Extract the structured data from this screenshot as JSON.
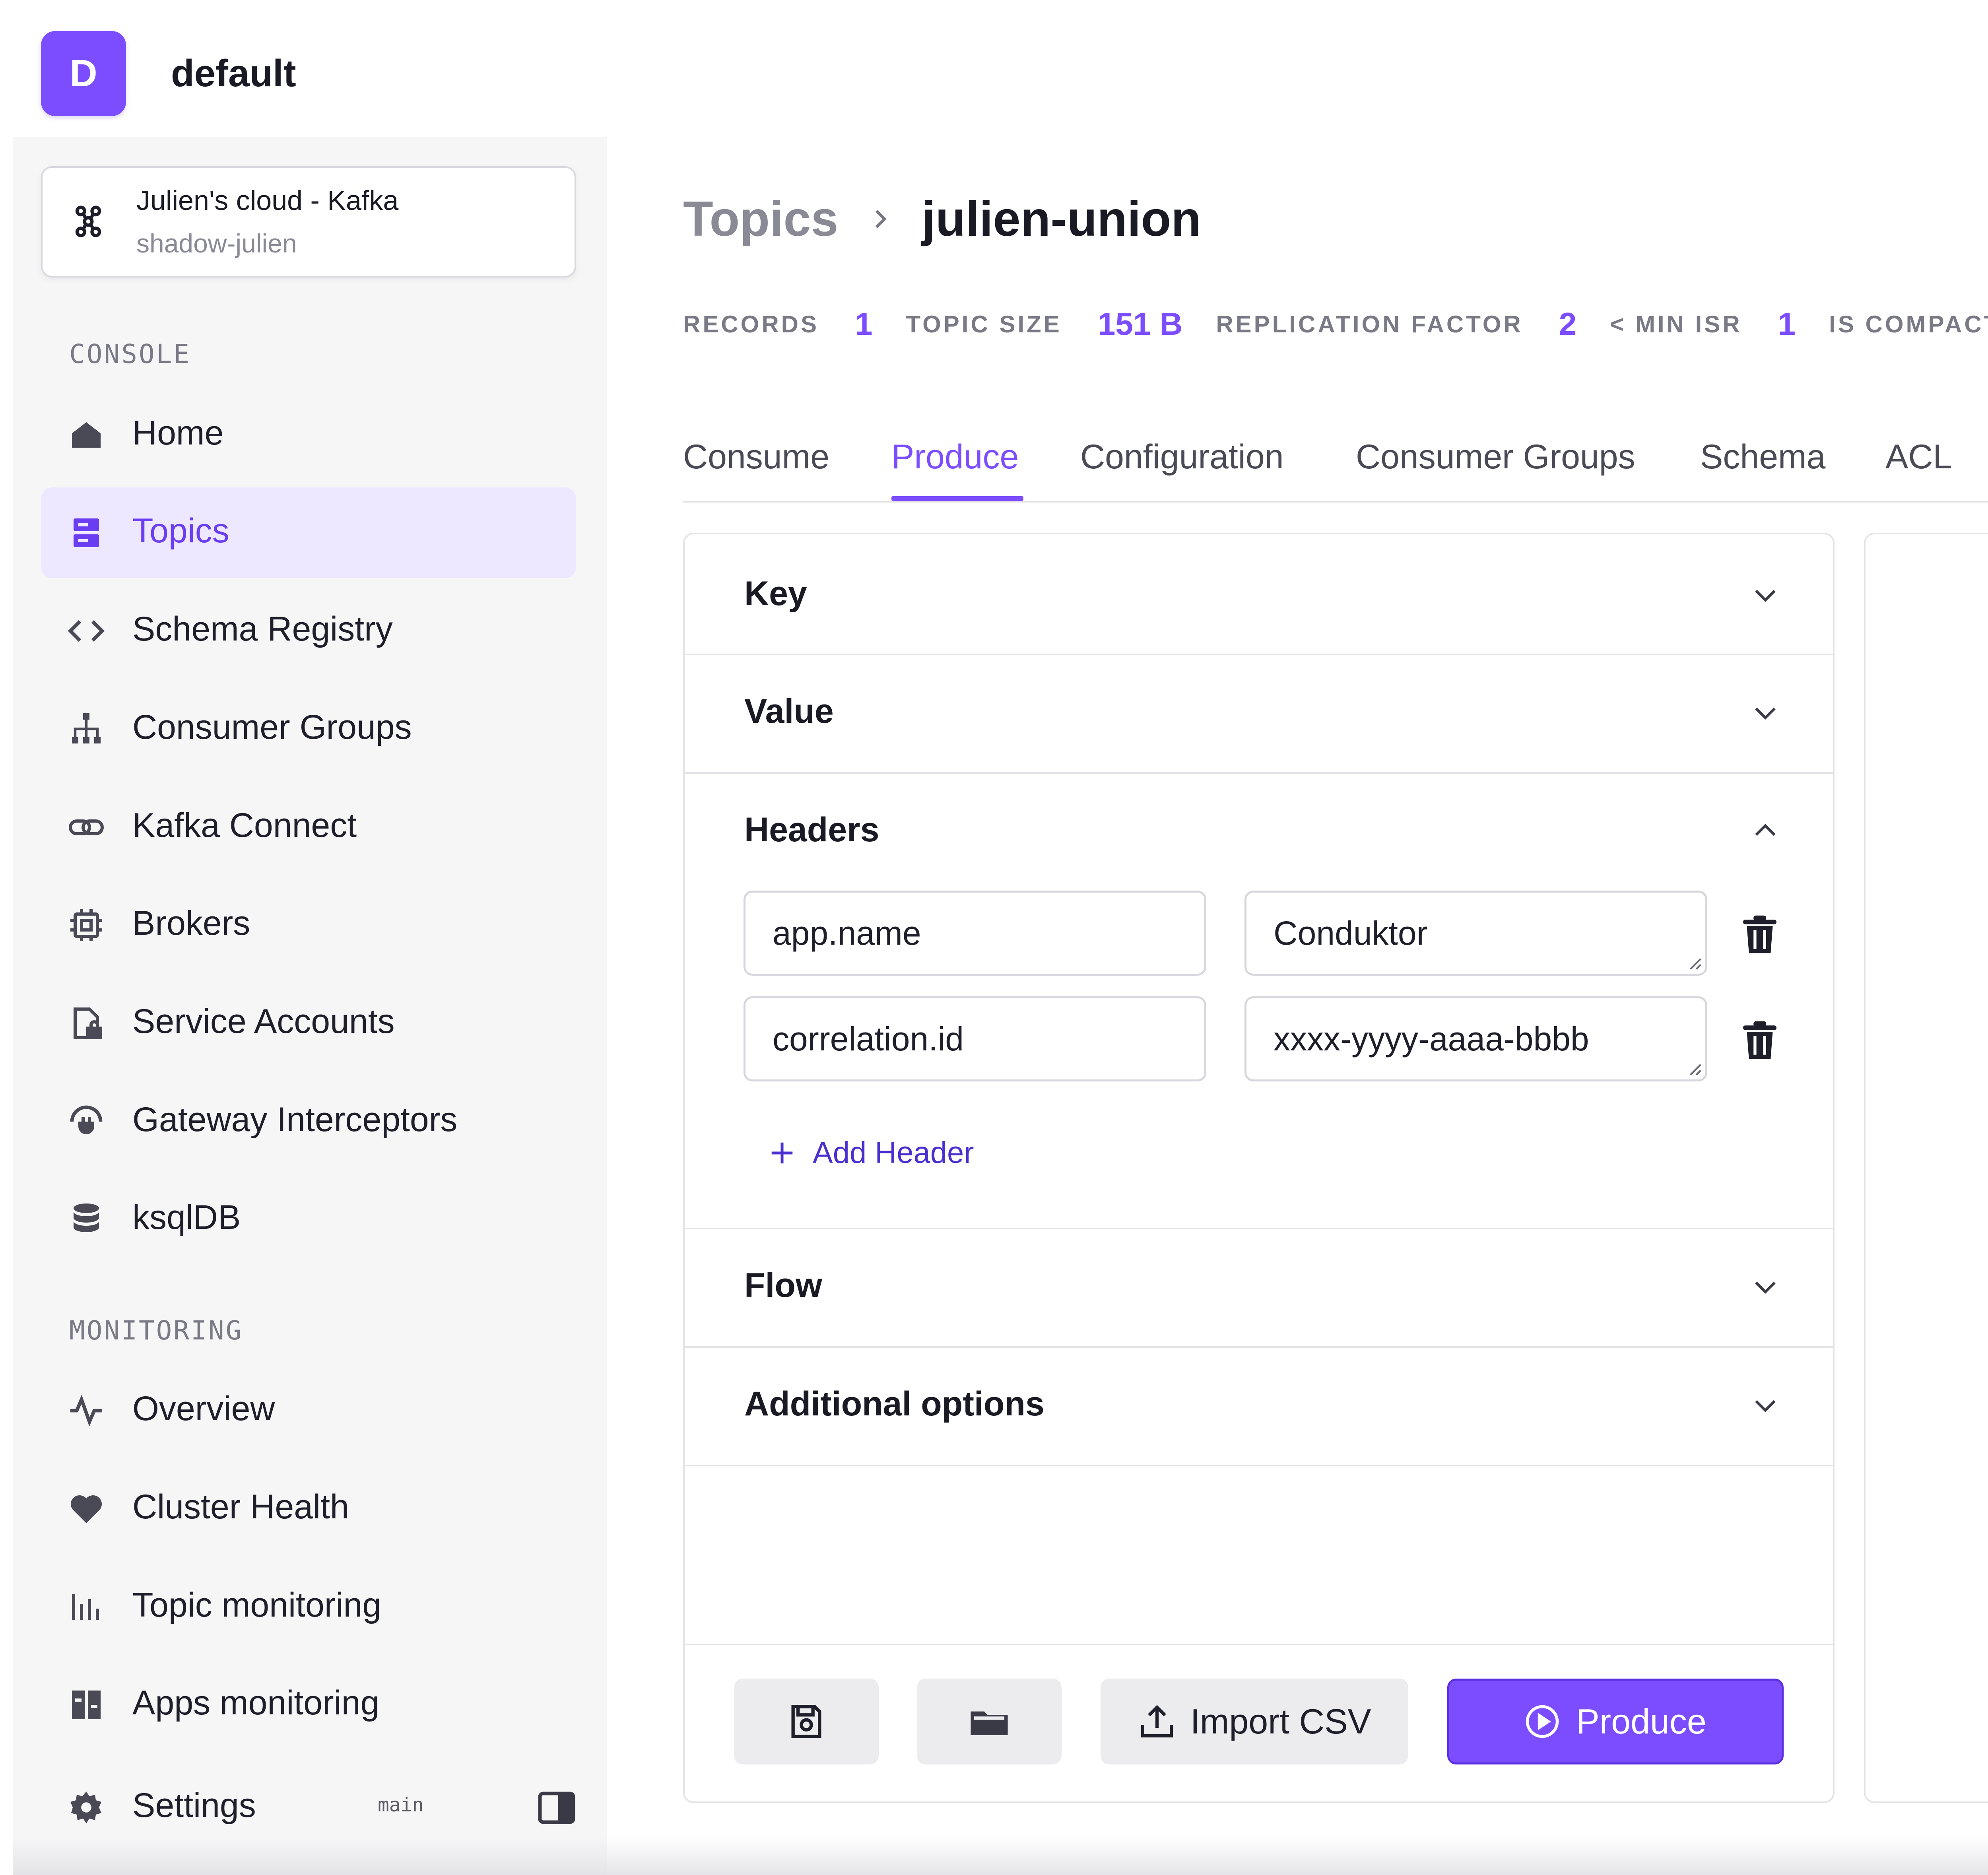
{
  "workspace": {
    "avatar_letter": "D",
    "name": "default"
  },
  "cluster": {
    "title": "Julien's cloud - Kafka",
    "subtitle": "shadow-julien"
  },
  "sidebar": {
    "console_label": "CONSOLE",
    "console_items": [
      {
        "label": "Home",
        "icon": "home-icon"
      },
      {
        "label": "Topics",
        "icon": "topics-icon",
        "active": true
      },
      {
        "label": "Schema Registry",
        "icon": "code-icon"
      },
      {
        "label": "Consumer Groups",
        "icon": "hierarchy-icon"
      },
      {
        "label": "Kafka Connect",
        "icon": "link-icon"
      },
      {
        "label": "Brokers",
        "icon": "chip-icon"
      },
      {
        "label": "Service Accounts",
        "icon": "file-lock-icon"
      },
      {
        "label": "Gateway Interceptors",
        "icon": "gateway-icon"
      },
      {
        "label": "ksqlDB",
        "icon": "database-icon"
      }
    ],
    "monitoring_label": "MONITORING",
    "monitoring_items": [
      {
        "label": "Overview",
        "icon": "activity-icon"
      },
      {
        "label": "Cluster Health",
        "icon": "heart-icon"
      },
      {
        "label": "Topic monitoring",
        "icon": "bar-chart-icon"
      },
      {
        "label": "Apps monitoring",
        "icon": "grid-icon"
      }
    ],
    "settings_label": "Settings",
    "branch": "main"
  },
  "breadcrumb": {
    "parent": "Topics",
    "current": "julien-union"
  },
  "stats": [
    {
      "label": "RECORDS",
      "value": "1"
    },
    {
      "label": "TOPIC SIZE",
      "value": "151 B"
    },
    {
      "label": "REPLICATION FACTOR",
      "value": "2"
    },
    {
      "label": "< MIN ISR",
      "value": "1"
    },
    {
      "label": "IS COMPACT",
      "value": ""
    }
  ],
  "tabs": [
    {
      "label": "Consume"
    },
    {
      "label": "Produce",
      "active": true
    },
    {
      "label": "Configuration"
    },
    {
      "label": "Consumer Groups"
    },
    {
      "label": "Schema"
    },
    {
      "label": "ACL"
    }
  ],
  "produce_form": {
    "sections": {
      "key": "Key",
      "value": "Value",
      "headers": "Headers",
      "flow": "Flow",
      "additional": "Additional options"
    },
    "headers": [
      {
        "key": "app.name",
        "value": "Conduktor"
      },
      {
        "key": "correlation.id",
        "value": "xxxx-yyyy-aaaa-bbbb"
      }
    ],
    "add_header_label": "Add Header",
    "buttons": {
      "import_csv": "Import CSV",
      "produce": "Produce"
    }
  },
  "colors": {
    "accent": "#7c4dff",
    "active_bg": "#ede7ff",
    "link": "#4b2ecf"
  }
}
